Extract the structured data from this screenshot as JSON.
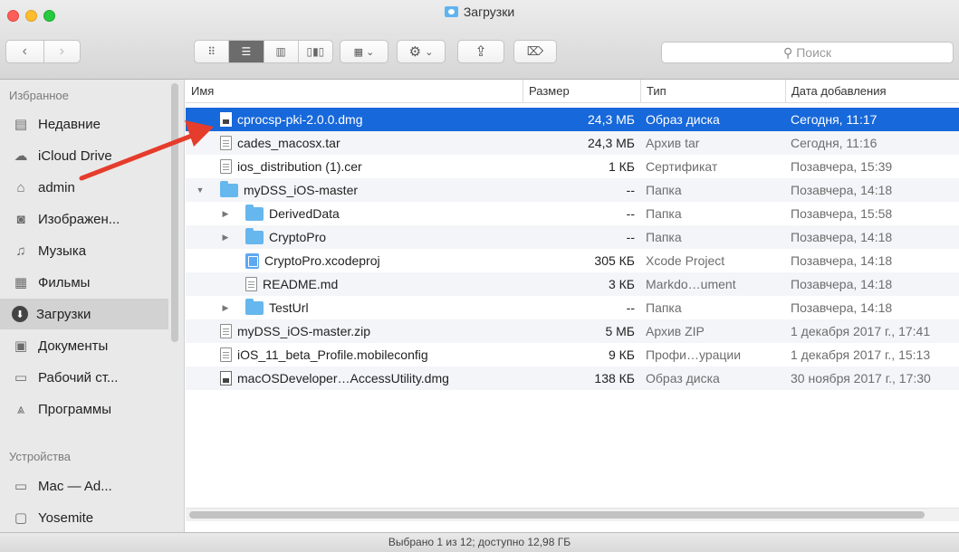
{
  "window": {
    "title": "Загрузки"
  },
  "toolbar": {
    "back_icon": "chevron-left-icon",
    "forward_icon": "chevron-right-icon",
    "view_modes": [
      "icon-view-icon",
      "list-view-icon",
      "column-view-icon",
      "cover-flow-icon"
    ],
    "active_view": "list-view-icon",
    "search_placeholder": "Поиск"
  },
  "sidebar": {
    "favorites_header": "Избранное",
    "devices_header": "Устройства",
    "favorites": [
      {
        "label": "Недавние",
        "icon": "recents-icon"
      },
      {
        "label": "iCloud Drive",
        "icon": "cloud-icon"
      },
      {
        "label": "admin",
        "icon": "home-icon"
      },
      {
        "label": "Изображен...",
        "icon": "camera-icon"
      },
      {
        "label": "Музыка",
        "icon": "music-icon"
      },
      {
        "label": "Фильмы",
        "icon": "film-icon"
      },
      {
        "label": "Загрузки",
        "icon": "downloads-icon",
        "selected": true
      },
      {
        "label": "Документы",
        "icon": "documents-icon"
      },
      {
        "label": "Рабочий ст...",
        "icon": "desktop-icon"
      },
      {
        "label": "Программы",
        "icon": "applications-icon"
      }
    ],
    "devices": [
      {
        "label": "Mac — Ad...",
        "icon": "computer-icon"
      },
      {
        "label": "Yosemite",
        "icon": "disk-icon"
      }
    ]
  },
  "columns": {
    "name": "Имя",
    "size": "Размер",
    "type": "Тип",
    "date": "Дата добавления"
  },
  "files": [
    {
      "name": "cprocsp-pki-2.0.0.dmg",
      "size": "24,3 МБ",
      "type": "Образ диска",
      "date": "Сегодня, 11:17",
      "icon": "dmg",
      "indent": 0,
      "selected": true
    },
    {
      "name": "cades_macosx.tar",
      "size": "24,3 МБ",
      "type": "Архив tar",
      "date": "Сегодня, 11:16",
      "icon": "doc",
      "indent": 0
    },
    {
      "name": "ios_distribution (1).cer",
      "size": "1 КБ",
      "type": "Сертификат",
      "date": "Позавчера, 15:39",
      "icon": "doc",
      "indent": 0
    },
    {
      "name": "myDSS_iOS-master",
      "size": "--",
      "type": "Папка",
      "date": "Позавчера, 14:18",
      "icon": "folder",
      "indent": 0,
      "disclosure": "open"
    },
    {
      "name": "DerivedData",
      "size": "--",
      "type": "Папка",
      "date": "Позавчера, 15:58",
      "icon": "folder",
      "indent": 1,
      "disclosure": "closed"
    },
    {
      "name": "CryptoPro",
      "size": "--",
      "type": "Папка",
      "date": "Позавчера, 14:18",
      "icon": "folder",
      "indent": 1,
      "disclosure": "closed"
    },
    {
      "name": "CryptoPro.xcodeproj",
      "size": "305 КБ",
      "type": "Xcode Project",
      "date": "Позавчера, 14:18",
      "icon": "xcode",
      "indent": 1
    },
    {
      "name": "README.md",
      "size": "3 КБ",
      "type": "Markdo…ument",
      "date": "Позавчера, 14:18",
      "icon": "doc",
      "indent": 1
    },
    {
      "name": "TestUrl",
      "size": "--",
      "type": "Папка",
      "date": "Позавчера, 14:18",
      "icon": "folder",
      "indent": 1,
      "disclosure": "closed"
    },
    {
      "name": "myDSS_iOS-master.zip",
      "size": "5 МБ",
      "type": "Архив ZIP",
      "date": "1 декабря 2017 г., 17:41",
      "icon": "doc",
      "indent": 0
    },
    {
      "name": "iOS_11_beta_Profile.mobileconfig",
      "size": "9 КБ",
      "type": "Профи…урации",
      "date": "1 декабря 2017 г., 15:13",
      "icon": "doc",
      "indent": 0
    },
    {
      "name": "macOSDeveloper…AccessUtility.dmg",
      "size": "138 КБ",
      "type": "Образ диска",
      "date": "30 ноября 2017 г., 17:30",
      "icon": "dmg",
      "indent": 0
    }
  ],
  "status": {
    "text": "Выбрано 1 из 12; доступно 12,98 ГБ"
  },
  "colors": {
    "selection": "#1768da",
    "folder": "#65b7ee",
    "arrow": "#e53c2c"
  }
}
